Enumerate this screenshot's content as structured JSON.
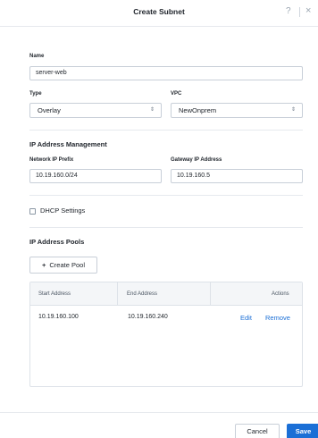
{
  "dialog": {
    "title": "Create Subnet",
    "help_icon": "?",
    "close_icon": "×"
  },
  "name": {
    "label": "Name",
    "value": "server-web"
  },
  "type": {
    "label": "Type",
    "value": "Overlay"
  },
  "vpc": {
    "label": "VPC",
    "value": "NewOnprem"
  },
  "ipam": {
    "title": "IP Address Management",
    "network_prefix_label": "Network IP Prefix",
    "network_prefix_value": "10.19.160.0/24",
    "gateway_label": "Gateway IP Address",
    "gateway_value": "10.19.160.5"
  },
  "dhcp": {
    "label": "DHCP Settings",
    "checked": false
  },
  "pools": {
    "title": "IP Address Pools",
    "create_button": "Create Pool",
    "columns": [
      "Start Address",
      "End Address",
      "Actions"
    ],
    "rows": [
      {
        "start": "10.19.160.100",
        "end": "10.19.160.240",
        "edit": "Edit",
        "remove": "Remove"
      }
    ]
  },
  "footer": {
    "cancel": "Cancel",
    "save": "Save"
  },
  "colors": {
    "accent": "#1b6fd6",
    "text": "#22272e",
    "border": "#c8cfd8"
  }
}
